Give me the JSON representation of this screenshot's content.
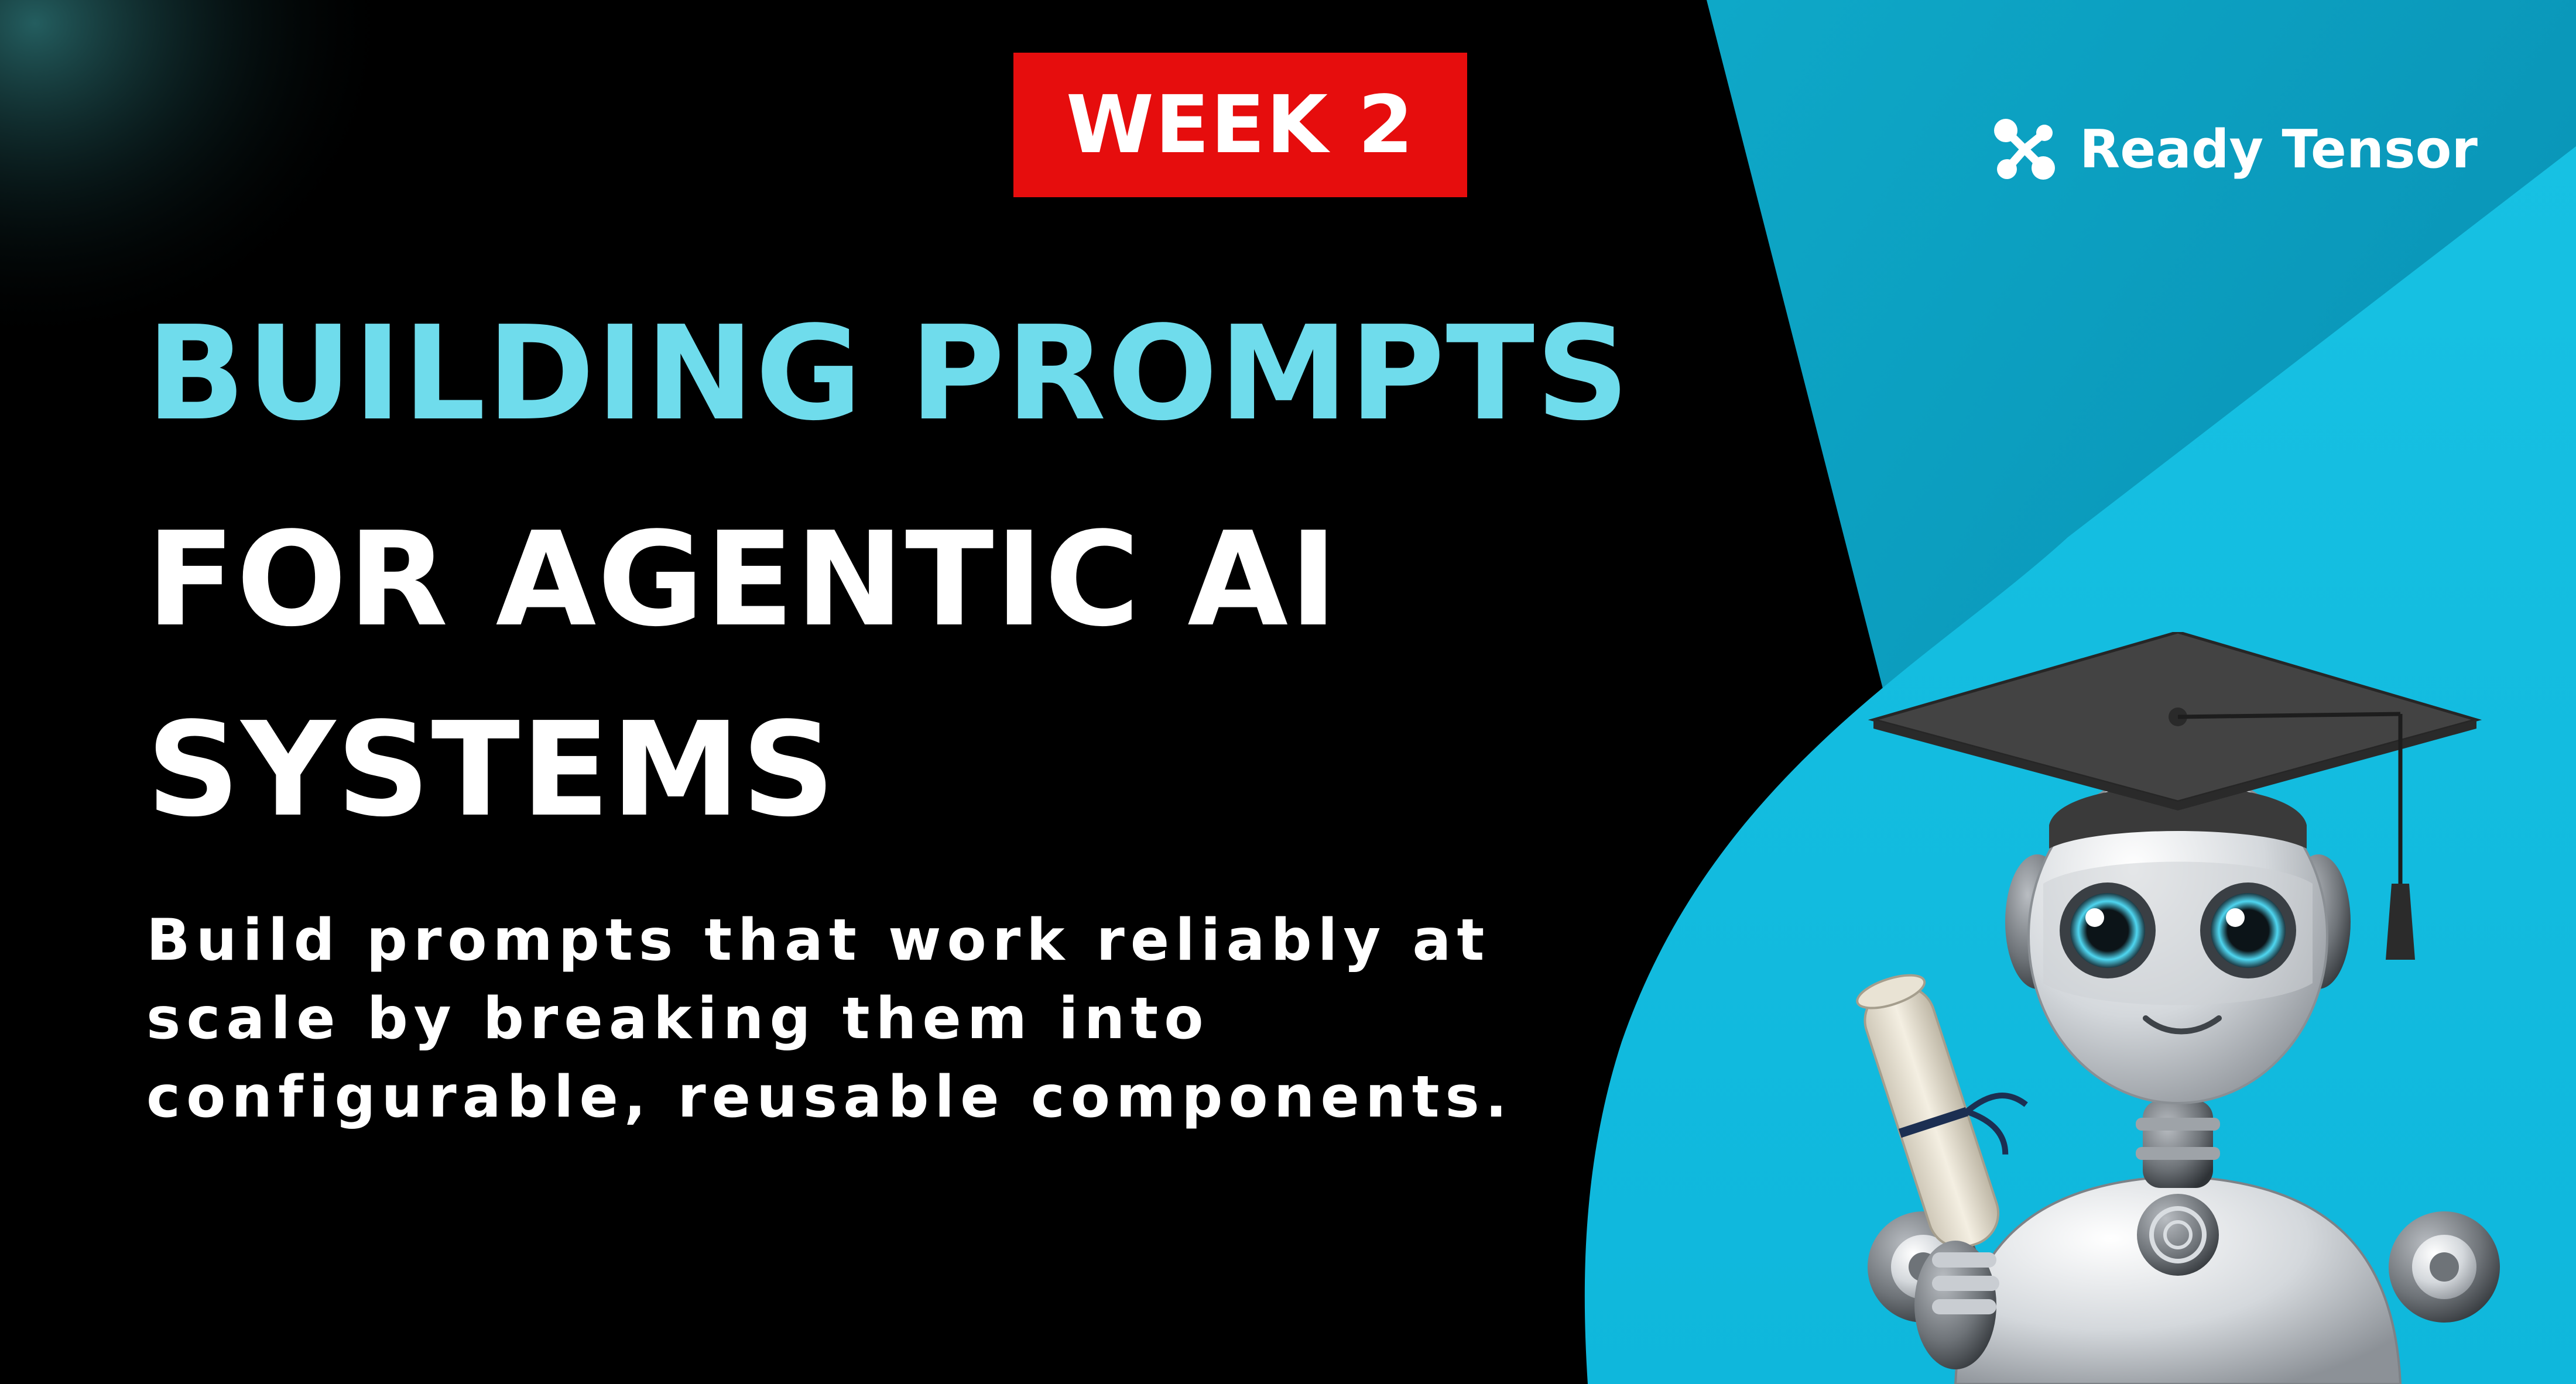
{
  "badge": {
    "label": "WEEK 2",
    "color": "#e60d0d"
  },
  "brand": {
    "name": "Ready Tensor",
    "icon": "network-nodes-icon"
  },
  "title": {
    "line1": "BUILDING PROMPTS",
    "line2": "FOR AGENTIC AI",
    "line3": "SYSTEMS",
    "accent_color": "#6fdcec"
  },
  "subtitle": "Build prompts that work reliably at scale by breaking them into configurable, reusable components.",
  "colors": {
    "background": "#000000",
    "panel_dark": "#0a9cc0",
    "panel_light": "#13bde0"
  },
  "mascot": {
    "icon": "graduate-robot-icon"
  }
}
